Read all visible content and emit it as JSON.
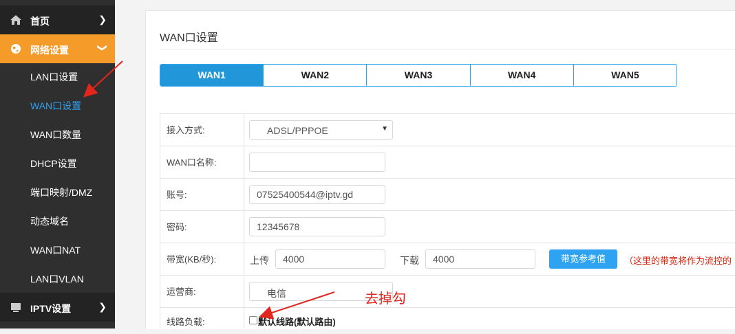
{
  "sidebar": {
    "home": "首页",
    "network": "网络设置",
    "items": [
      "LAN口设置",
      "WAN口设置",
      "WAN口数量",
      "DHCP设置",
      "端口映射/DMZ",
      "动态域名",
      "WAN口NAT",
      "LAN口VLAN"
    ],
    "active_item": "WAN口设置",
    "iptv": "IPTV设置"
  },
  "main": {
    "title": "WAN口设置",
    "tabs": [
      "WAN1",
      "WAN2",
      "WAN3",
      "WAN4",
      "WAN5"
    ],
    "active_tab": "WAN1",
    "form": {
      "access_label": "接入方式:",
      "access_value": "ADSL/PPPOE",
      "name_label": "WAN口名称:",
      "name_value": "",
      "account_label": "账号:",
      "account_value": "07525400544@iptv.gd",
      "password_label": "密码:",
      "password_value": "12345678",
      "bandwidth_label": "带宽(KB/秒):",
      "upload_label": "上传",
      "upload_value": "4000",
      "download_label": "下载",
      "download_value": "4000",
      "bandwidth_button": "带宽参考值",
      "bandwidth_note": "（这里的带宽将作为流控的",
      "isp_label": "运营商:",
      "isp_value": "电信",
      "load_label": "线路负载:",
      "default_line_label": "默认线路(默认路由)",
      "default_line_checked": false
    }
  },
  "annotation": {
    "text": "去掉勾",
    "color": "#e0261d"
  },
  "colors": {
    "accent": "#2ea3f2",
    "tab_active": "#2196d9",
    "sidebar_active": "#f49b2a",
    "sidebar_bg": "#2f2f2f"
  }
}
